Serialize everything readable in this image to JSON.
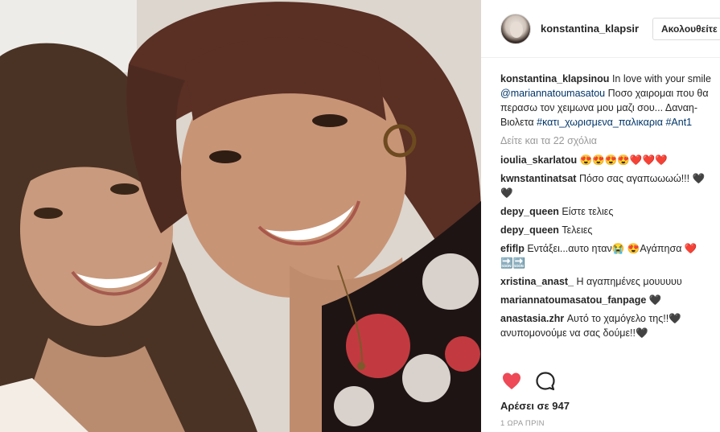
{
  "post": {
    "username": "konstantina_klapsir",
    "follow_label": "Ακολουθείτε",
    "caption": {
      "user": "konstantina_klapsinou",
      "text1": "In love with your smile ",
      "mention": "@mariannatoumasatou",
      "text2": " Ποσο χαιρομαι που θα περασω τον χειμωνα μου μαζι σου... Δαναη-Βιολετα ",
      "hashtags": "#κατι_χωρισμενα_παλικαρια #Ant1"
    },
    "load_more": "Δείτε και τα 22 σχόλια",
    "comments": [
      {
        "user": "ioulia_skarlatou",
        "text": "😍😍😍😍❤️❤️❤️"
      },
      {
        "user": "kwnstantinatsat",
        "text": "Πόσο σας αγαπωωωώ!!! 🖤🖤"
      },
      {
        "user": "depy_queen",
        "text": "Είστε τελιες"
      },
      {
        "user": "depy_queen",
        "text": "Τελειες"
      },
      {
        "user": "efiflp",
        "text": "Εντάξει...αυτο ηταν😭 😍Αγάπησα ❤️🔜🔜"
      },
      {
        "user": "xristina_anast_",
        "text": "Η αγαπημένες μουυυυυ"
      },
      {
        "user": "mariannatoumasatou_fanpage",
        "text": "🖤"
      },
      {
        "user": "anastasia.zhr",
        "text": "Αυτό το χαμόγελο της!!🖤 ανυπομονούμε να σας δούμε!!🖤"
      }
    ],
    "likes": "Αρέσει σε 947",
    "time": "1 ΩΡΑ ΠΡΙΝ"
  },
  "icons": {
    "like": "heart-icon",
    "comment": "comment-bubble-icon"
  },
  "colors": {
    "like_red": "#ed4956",
    "link_blue": "#003569",
    "muted": "#999999",
    "text": "#262626"
  }
}
